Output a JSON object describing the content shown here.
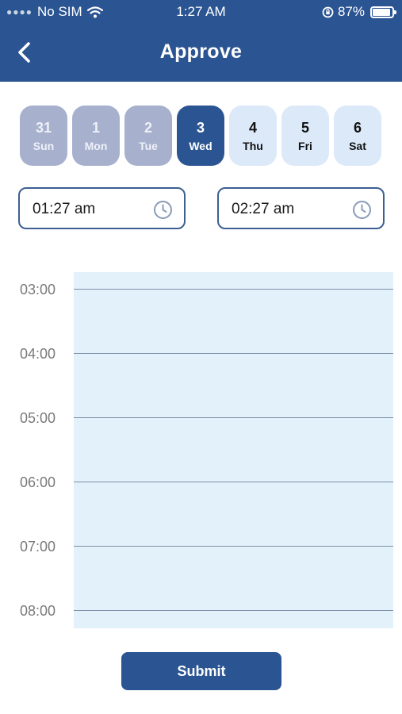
{
  "status_bar": {
    "carrier": "No SIM",
    "time": "1:27 AM",
    "battery": "87%"
  },
  "header": {
    "title": "Approve",
    "back_icon": "chevron-left-icon"
  },
  "days": [
    {
      "num": "31",
      "dow": "Sun",
      "state": "past"
    },
    {
      "num": "1",
      "dow": "Mon",
      "state": "past"
    },
    {
      "num": "2",
      "dow": "Tue",
      "state": "past"
    },
    {
      "num": "3",
      "dow": "Wed",
      "state": "selected"
    },
    {
      "num": "4",
      "dow": "Thu",
      "state": "future"
    },
    {
      "num": "5",
      "dow": "Fri",
      "state": "future"
    },
    {
      "num": "6",
      "dow": "Sat",
      "state": "future"
    }
  ],
  "time_range": {
    "start": "01:27 am",
    "end": "02:27 am",
    "icon": "clock-icon"
  },
  "timeline": {
    "hours": [
      "03:00",
      "04:00",
      "05:00",
      "06:00",
      "07:00",
      "08:00"
    ]
  },
  "submit_label": "Submit",
  "colors": {
    "primary": "#2b5592",
    "past_day": "#a7b0cd",
    "future_day": "#dbe9f8",
    "timeline_bg": "#e3f1fb"
  }
}
